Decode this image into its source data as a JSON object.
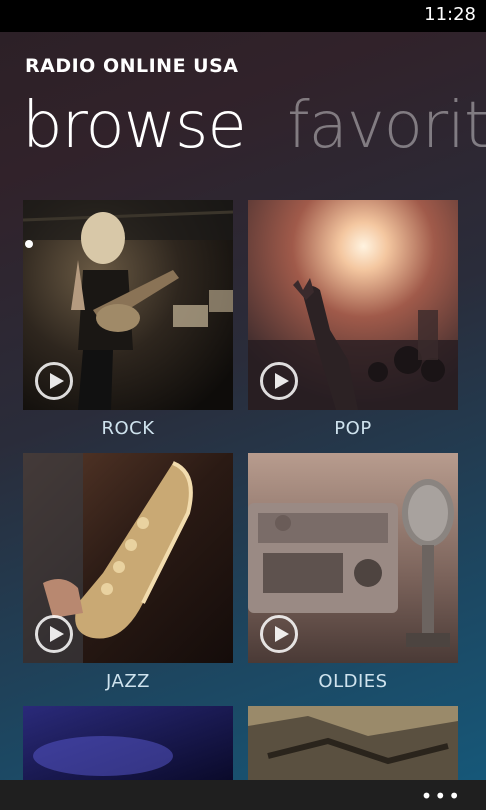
{
  "status_bar": {
    "time": "11:28"
  },
  "app": {
    "title": "RADIO ONLINE USA"
  },
  "pivot": {
    "tabs": [
      "browse",
      "favorite"
    ]
  },
  "genres": [
    {
      "label": "ROCK"
    },
    {
      "label": "POP"
    },
    {
      "label": "JAZZ"
    },
    {
      "label": "OLDIES"
    }
  ],
  "icons": {
    "play": "play-circle-icon",
    "more": "more-dots-icon"
  },
  "app_bar": {
    "more_label": "•••"
  }
}
